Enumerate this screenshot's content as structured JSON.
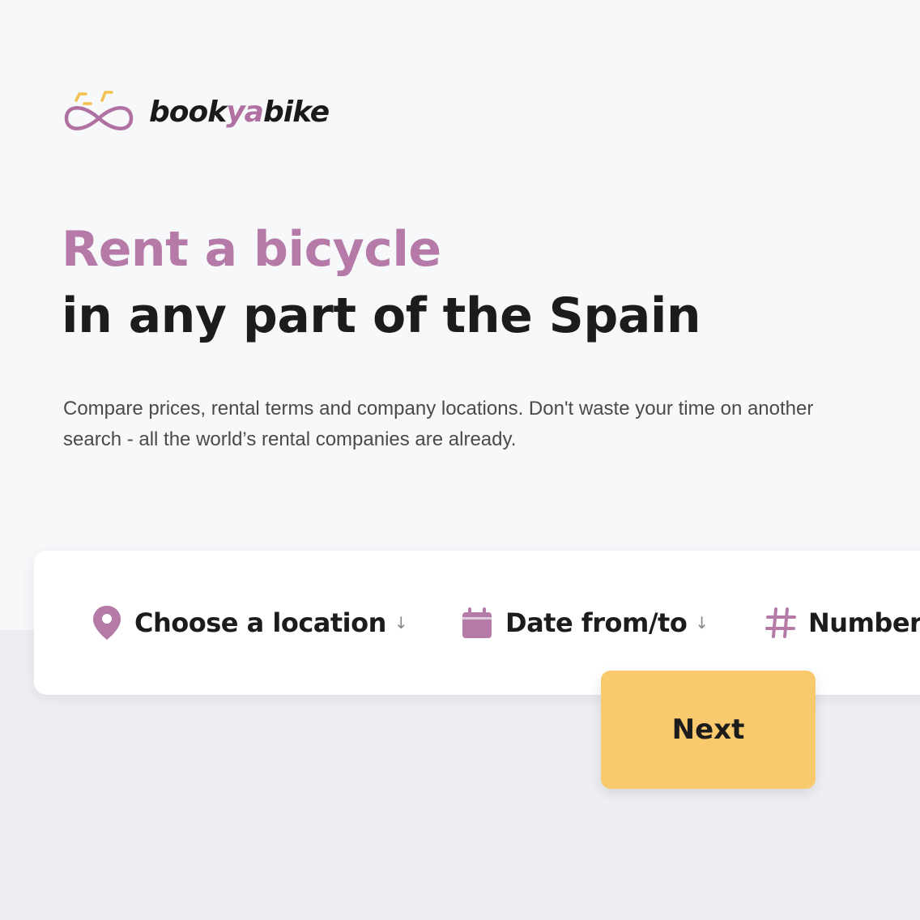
{
  "brand": {
    "name_prefix": "book",
    "name_accent": "ya",
    "name_suffix": "bike"
  },
  "hero": {
    "title_line1": "Rent a bicycle",
    "title_line2": "in any part of the Spain",
    "subtitle": "Compare prices, rental terms and company locations. Don't waste your time on another search - all the world’s rental companies are already."
  },
  "search": {
    "location_label": "Choose a location",
    "date_label": "Date from/to",
    "number_label": "Number",
    "next_label": "Next",
    "arrow_glyph": "↓"
  },
  "icons": {
    "location": "map-pin-icon",
    "date": "calendar-icon",
    "number": "hash-icon",
    "logo": "bike-infinity-logo"
  },
  "colors": {
    "accent": "#b57aa7",
    "button": "#f9c96d",
    "logo_handlebar": "#f2c14e",
    "text_dark": "#1c1c1c"
  }
}
